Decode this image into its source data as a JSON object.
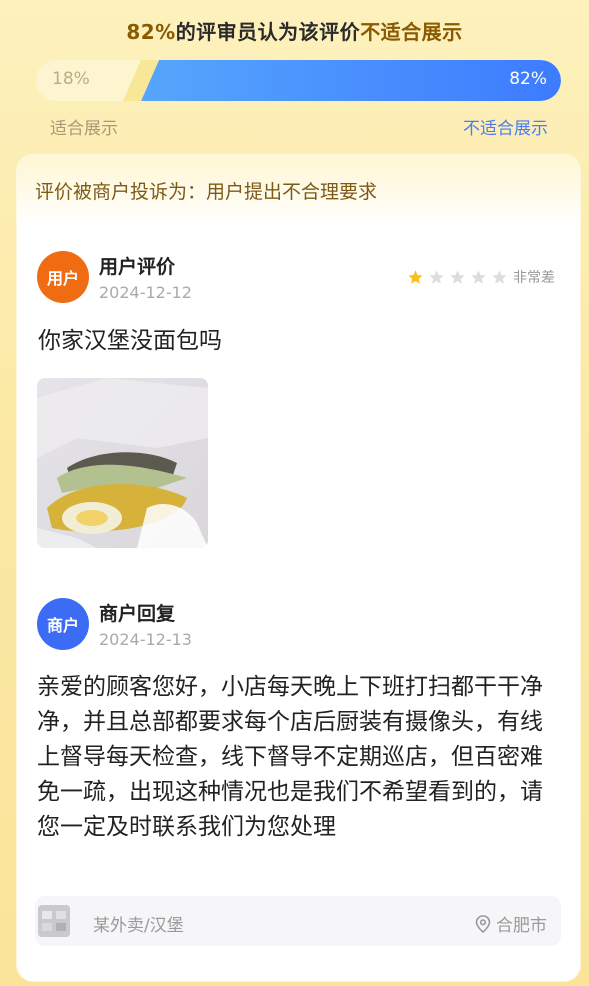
{
  "summary": {
    "percent": "82%",
    "text": "的评审员认为该评价",
    "verdict": "不适合展示"
  },
  "vote_bar": {
    "left_value": "18%",
    "right_value": "82%",
    "left_fraction": 0.18,
    "right_fraction": 0.82,
    "left_label": "适合展示",
    "right_label": "不适合展示",
    "right_color": "#3d7bff"
  },
  "complaint": {
    "text": "评价被商户投诉为：用户提出不合理要求"
  },
  "user_review": {
    "avatar_label": "用户",
    "title": "用户评价",
    "date": "2024-12-12",
    "rating": 1,
    "rating_max": 5,
    "rating_label": "非常差",
    "text": "你家汉堡没面包吗",
    "photo_icon": "burger-photo"
  },
  "merchant_reply": {
    "avatar_label": "商户",
    "title": "商户回复",
    "date": "2024-12-13",
    "text": "亲爱的顾客您好，小店每天晚上下班打扫都干干净净，并且总部都要求每个店后厨装有摄像头，有线上督导每天检查，线下督导不定期巡店，但百密难免一疏，出现这种情况也是我们不希望看到的，请您一定及时联系我们为您处理"
  },
  "footer": {
    "store": "某外卖/汉堡",
    "location": "合肥市",
    "location_icon": "location-pin-icon"
  },
  "colors": {
    "accent_gold": "#8a5a00",
    "user_avatar": "#ef6c12",
    "merchant_avatar": "#3d6cf4",
    "star_filled": "#f7c01b",
    "star_empty": "#dddddd"
  }
}
